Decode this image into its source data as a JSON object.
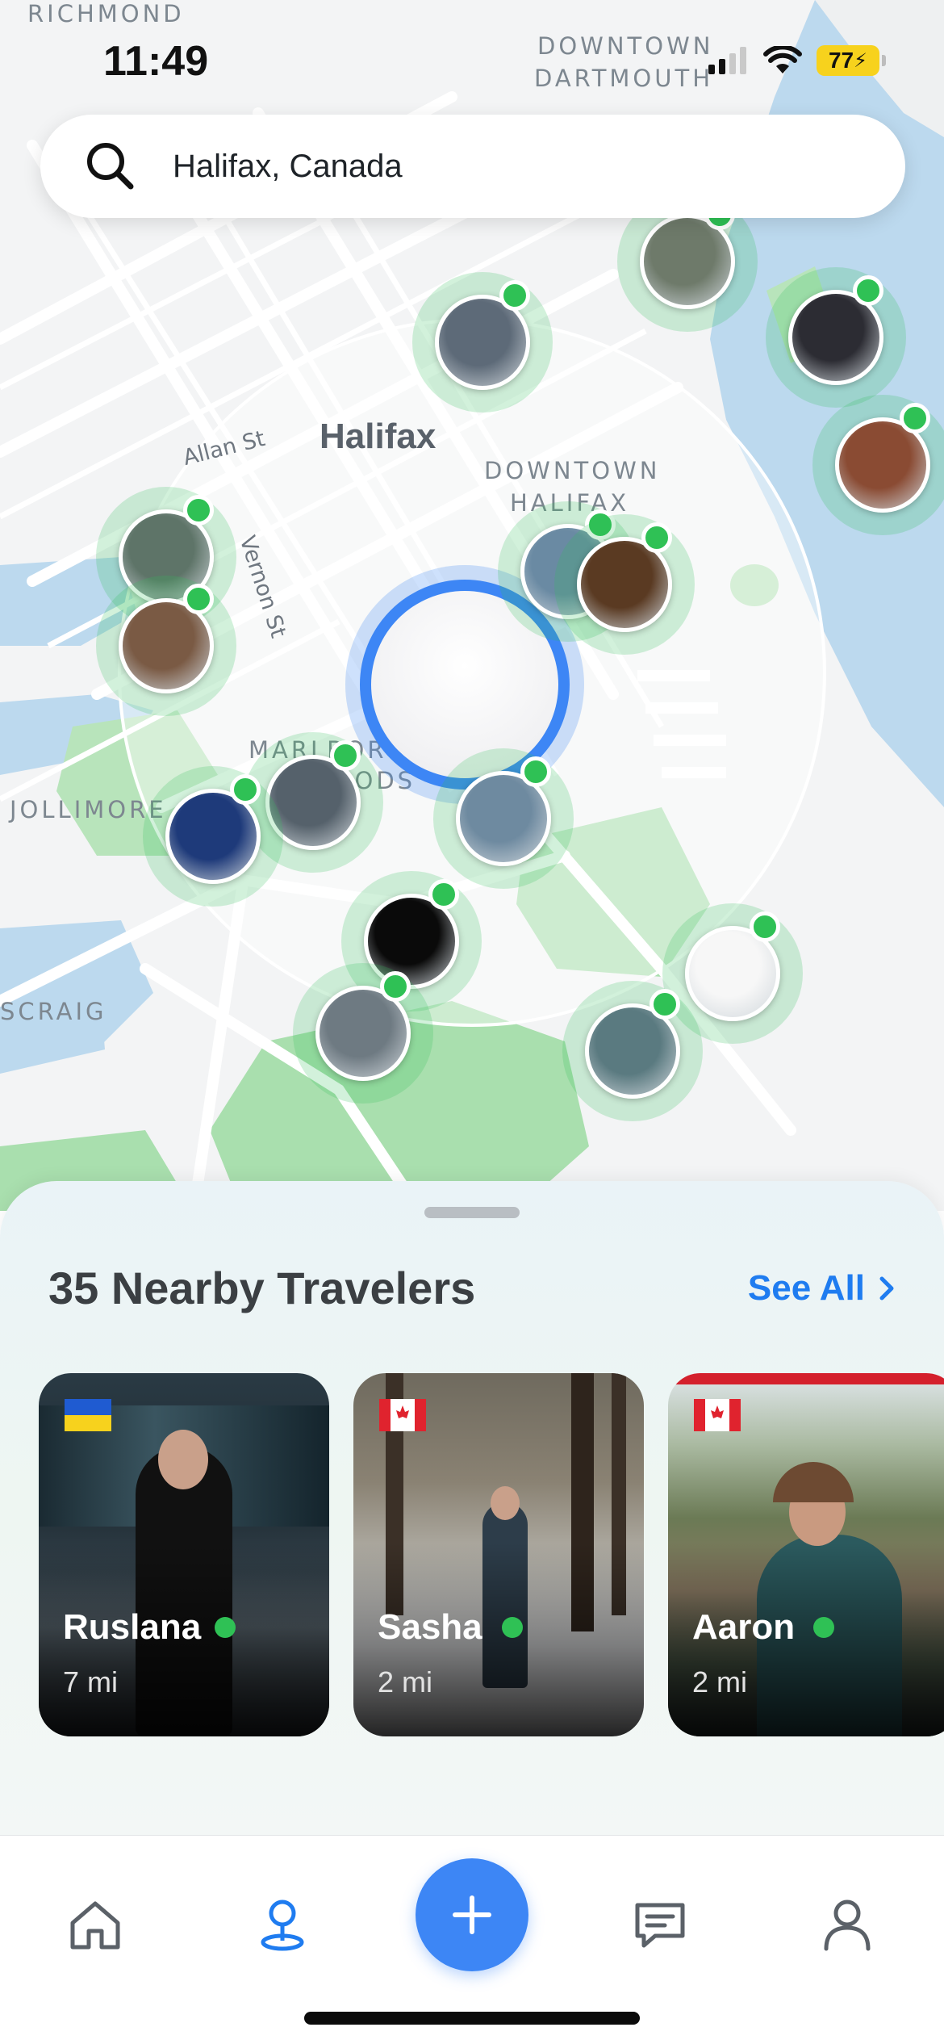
{
  "status_bar": {
    "time": "11:49",
    "battery": "77",
    "icons": [
      "cellular-signal-icon",
      "wifi-icon",
      "battery-charging-icon"
    ]
  },
  "map": {
    "labels": {
      "richmond": "RICHMOND",
      "downtown_dartmouth_1": "DOWNTOWN",
      "downtown_dartmouth_2": "DARTMOUTH",
      "city": "Halifax",
      "downtown_halifax_1": "DOWNTOWN",
      "downtown_halifax_2": "HALIFAX",
      "allan_st": "Allan St",
      "vernon_st": "Vernon St",
      "marlborough_1": "MARLBOROU",
      "marlborough_2": "WOODS",
      "jollimore": "JOLLIMORE",
      "scraig": "SCRAIG"
    },
    "user_count_pins": 17
  },
  "search": {
    "value": "Halifax, Canada",
    "icon": "search-icon"
  },
  "sheet": {
    "title": "35 Nearby Travelers",
    "see_all": "See All",
    "travelers": [
      {
        "name": "Ruslana",
        "distance": "7 mi",
        "flag": "ukraine-flag",
        "online": true
      },
      {
        "name": "Sasha",
        "distance": "2 mi",
        "flag": "canada-flag",
        "online": true
      },
      {
        "name": "Aaron",
        "distance": "2 mi",
        "flag": "canada-flag",
        "online": true
      }
    ]
  },
  "tab_bar": {
    "tabs": [
      "home-icon",
      "map-pin-icon",
      "add-icon",
      "chat-icon",
      "profile-icon"
    ],
    "active": "map-pin-icon"
  },
  "colors": {
    "accent_blue": "#3d86f5",
    "link_blue": "#1f7cf0",
    "online_green": "#2fc155",
    "water": "#bcd9ee",
    "park": "#a9dfae"
  }
}
